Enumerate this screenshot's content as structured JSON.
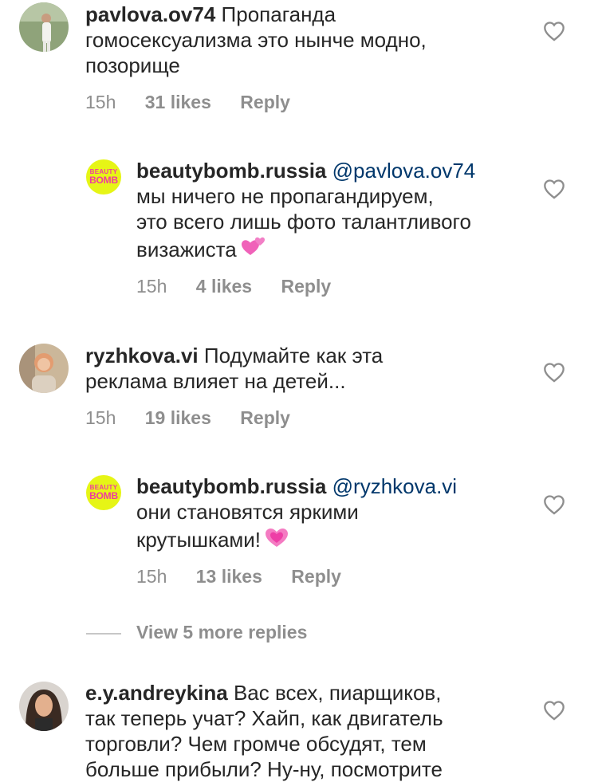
{
  "comments": [
    {
      "username": "pavlova.ov74",
      "text_lines": [
        "Пропаганда",
        "гомосексуализма это нынче модно,",
        "позорище"
      ],
      "time": "15h",
      "likes": "31 likes",
      "reply": "Reply"
    },
    {
      "username": "beautybomb.russia",
      "mention": "@pavlova.ov74",
      "text_lines": [
        "мы ничего не пропагандируем,",
        "это всего лишь фото талантливого",
        "визажиста"
      ],
      "emoji": "two-hearts",
      "time": "15h",
      "likes": "4 likes",
      "reply": "Reply"
    },
    {
      "username": "ryzhkova.vi",
      "text_lines": [
        "Подумайте как эта",
        "реклама влияет на детей..."
      ],
      "time": "15h",
      "likes": "19 likes",
      "reply": "Reply"
    },
    {
      "username": "beautybomb.russia",
      "mention": "@ryzhkova.vi",
      "text_lines": [
        "они становятся яркими",
        "крутышками!"
      ],
      "emoji": "growing-heart",
      "time": "15h",
      "likes": "13 likes",
      "reply": "Reply"
    },
    {
      "username": "e.y.andreykina",
      "text_lines": [
        "Вас всех, пиарщиков,",
        "так теперь учат? Хайп, как двигатель",
        "торговли? Чем громче обсудят, тем",
        "больше прибыли? Ну-ну, посмотрите"
      ]
    }
  ],
  "brand_avatar": {
    "top": "BEAUTY",
    "bottom": "BOMB"
  },
  "view_more": "View 5 more replies",
  "icons": {
    "like": "heart-outline-icon"
  },
  "colors": {
    "username": "#262626",
    "mention": "#00376b",
    "meta": "#8e8e8e",
    "brand_bg": "#e6f516",
    "brand_fg": "#ef3ba0"
  }
}
